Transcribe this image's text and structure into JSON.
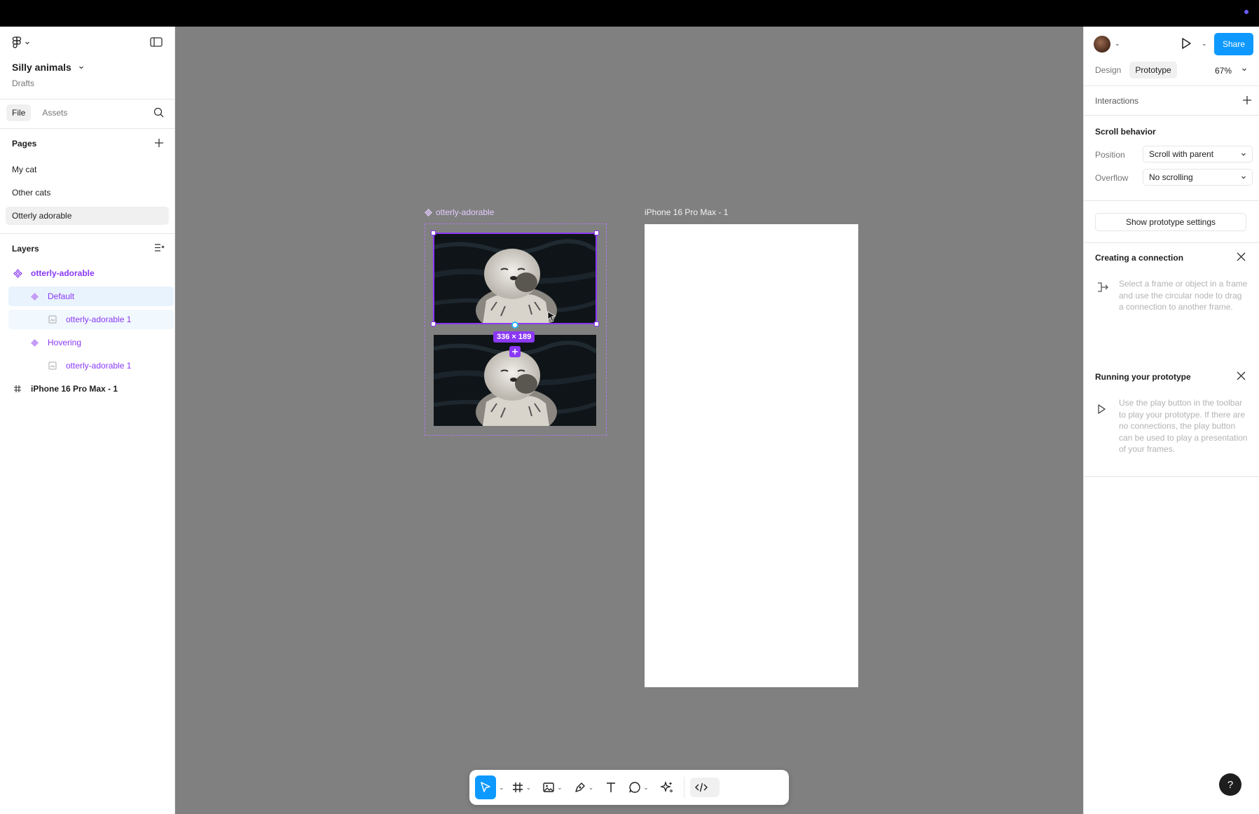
{
  "file": {
    "title": "Silly animals",
    "location": "Drafts"
  },
  "left_tabs": {
    "file": "File",
    "assets": "Assets"
  },
  "pages": {
    "heading": "Pages",
    "items": [
      {
        "label": "My cat"
      },
      {
        "label": "Other cats"
      },
      {
        "label": "Otterly adorable"
      }
    ]
  },
  "layers": {
    "heading": "Layers",
    "items": [
      {
        "label": "otterly-adorable",
        "type": "component-set"
      },
      {
        "label": "Default",
        "type": "variant"
      },
      {
        "label": "otterly-adorable 1",
        "type": "image"
      },
      {
        "label": "Hovering",
        "type": "variant"
      },
      {
        "label": "otterly-adorable 1",
        "type": "image"
      },
      {
        "label": "iPhone 16 Pro Max - 1",
        "type": "frame"
      }
    ]
  },
  "canvas": {
    "component_label": "otterly-adorable",
    "frame_label": "iPhone 16 Pro Max - 1",
    "selection_size": "336 × 189"
  },
  "right": {
    "share_label": "Share",
    "tabs": {
      "design": "Design",
      "prototype": "Prototype"
    },
    "zoom": "67%",
    "interactions": "Interactions",
    "scroll_behavior": {
      "heading": "Scroll behavior",
      "position_label": "Position",
      "position_value": "Scroll with parent",
      "overflow_label": "Overflow",
      "overflow_value": "No scrolling"
    },
    "show_settings": "Show prototype settings",
    "creating": {
      "heading": "Creating a connection",
      "text": "Select a frame or object in a frame and use the circular node to drag a connection to another frame."
    },
    "running": {
      "heading": "Running your prototype",
      "text": "Use the play button in the toolbar to play your prototype. If there are no connections, the play button can be used to play a presentation of your frames."
    },
    "help": "?"
  },
  "colors": {
    "accent": "#0d99ff",
    "component": "#8a38f5",
    "canvas": "#808080"
  }
}
